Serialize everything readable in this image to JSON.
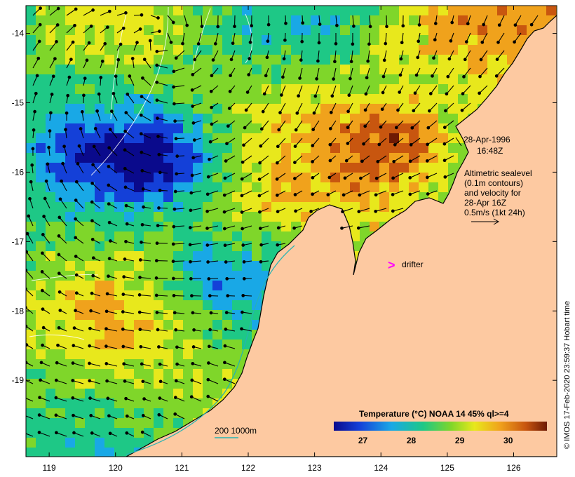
{
  "title": "",
  "annotation": {
    "date": "28-Apr-1996",
    "time": "16:48Z",
    "legend_lines": [
      "Altimetric sealevel",
      "(0.1m contours)",
      "and velocity for",
      "28-Apr 16Z",
      "0.5m/s (1kt 24h)"
    ]
  },
  "drifter": {
    "symbol": ">",
    "label": "drifter",
    "color": "#ff00ff"
  },
  "depth_legend": {
    "label": "200  1000m"
  },
  "colorbar": {
    "title": "Temperature (°C) NOAA 14 45% ql>=4",
    "ticks": [
      "27",
      "28",
      "29",
      "30"
    ],
    "range": [
      26.4,
      30.8
    ]
  },
  "credit": "© IMOS 17-Feb-2020 23:59:37 Hobart time",
  "chart_data": {
    "type": "heatmap",
    "x_ticks": [
      "119",
      "120",
      "121",
      "122",
      "123",
      "124",
      "125",
      "126"
    ],
    "y_ticks": [
      "-14",
      "-15",
      "-16",
      "-17",
      "-18",
      "-19"
    ],
    "xlim": [
      118.65,
      126.65
    ],
    "ylim": [
      -20.1,
      -13.6
    ],
    "variable": "sea surface temperature",
    "units": "°C"
  },
  "colors": {
    "land": "#fdc9a1",
    "coast": "#000000",
    "contour": "#ffffff",
    "isobath": "#26b3b3",
    "arrow": "#000000"
  }
}
